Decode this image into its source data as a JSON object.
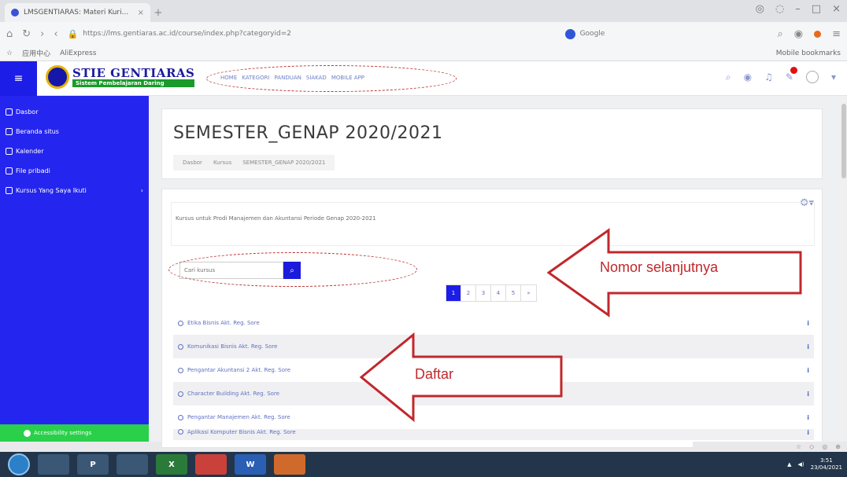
{
  "browser": {
    "tab_title": "LMSGENTIARAS: Materi Kuri...",
    "tab_close": "×",
    "new_tab": "+",
    "url": "https://lms.gentiaras.ac.id/course/index.php?categoryid=2",
    "search_engine": "Google",
    "bookmarks": [
      "应用中心",
      "AliExpress"
    ],
    "mobile_bookmarks": "Mobile bookmarks"
  },
  "site": {
    "logo_title": "STIE GENTIARAS",
    "logo_subtitle": "Sistem Pembelajaran Daring",
    "menu": [
      "HOME",
      "KATEGORI",
      "PANDUAN",
      "SIAKAD",
      "MOBILE APP"
    ]
  },
  "sidebar": {
    "items": [
      {
        "label": "Dasbor"
      },
      {
        "label": "Beranda situs"
      },
      {
        "label": "Kalender"
      },
      {
        "label": "File pribadi"
      },
      {
        "label": "Kursus Yang Saya Ikuti"
      }
    ],
    "accessibility": "Accessibility settings"
  },
  "page": {
    "title": "SEMESTER_GENAP 2020/2021",
    "breadcrumb": [
      "Dasbor",
      "Kursus",
      "SEMESTER_GENAP 2020/2021"
    ],
    "summary": "Kursus untuk Prodi Manajemen dan Akuntansi Periode Genap 2020-2021",
    "search_placeholder": "Cari kursus",
    "pages": [
      "1",
      "2",
      "3",
      "4",
      "5",
      "»"
    ],
    "active_page": "1",
    "courses": [
      "Etika Bisnis Akt. Reg. Sore",
      "Komunikasi Bisnis Akt. Reg. Sore",
      "Pengantar Akuntansi 2 Akt. Reg. Sore",
      "Character Building Akt. Reg. Sore",
      "Pengantar Manajemen Akt. Reg. Sore",
      "Aplikasi Komputer Bisnis Akt. Reg. Sore"
    ]
  },
  "annotations": {
    "next_label": "Nomor selanjutnya",
    "list_label": "Daftar",
    "color": "#c0282c"
  },
  "taskbar": {
    "apps": [
      "",
      "",
      "P",
      "",
      "X",
      "",
      "W",
      ""
    ],
    "time": "3:51",
    "date": "23/04/2021"
  },
  "colors": {
    "sidebar": "#2525f0",
    "accent": "#1d1de8",
    "accessibility": "#2ad04a"
  }
}
